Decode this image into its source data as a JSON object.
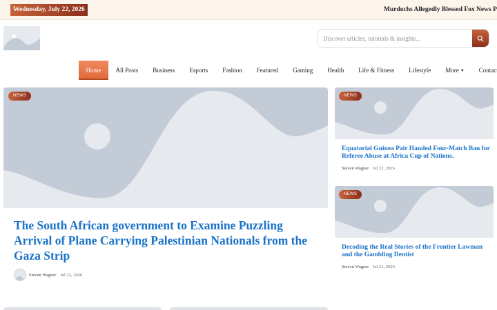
{
  "topbar": {
    "date": "Wednesday, July 22, 2026",
    "ticker": "Murdochs Allegedly Blessed Fox News Plan to Reshape"
  },
  "header": {
    "search_placeholder": "Discover articles, tutorials & insights..."
  },
  "nav": {
    "items": [
      {
        "label": "Home",
        "active": true
      },
      {
        "label": "All Posts"
      },
      {
        "label": "Business"
      },
      {
        "label": "Esports"
      },
      {
        "label": "Fashion"
      },
      {
        "label": "Featured"
      },
      {
        "label": "Gaming"
      },
      {
        "label": "Health"
      },
      {
        "label": "Life & Fitness"
      },
      {
        "label": "Lifestyle"
      },
      {
        "label": "More"
      },
      {
        "label": "Contact Us"
      }
    ]
  },
  "hero": {
    "badge": "NEWS",
    "title": "The South African government to Examine Puzzling Arrival of Plane Carrying Palestinian Nationals from the Gaza Strip",
    "author": "Steven Wagner",
    "date": "Jul 22, 2026"
  },
  "side_posts": [
    {
      "badge": "NEWS",
      "title": "Equatorial Guinea Pair Handed Four-Match Ban for Referee Abuse at Africa Cup of Nations.",
      "author": "Steven Wagner",
      "date": "Jul 22, 2026"
    },
    {
      "badge": "NEWS",
      "title": "Decoding the Real Stories of the Frontier Lawman and the Gambling Dentist",
      "author": "Steven Wagner",
      "date": "Jul 21, 2026"
    }
  ],
  "colors": {
    "accent": "#e06a3c",
    "accent_dark": "#8a2e1c",
    "link": "#1a73c8",
    "placeholder": "#c3cbd6"
  }
}
